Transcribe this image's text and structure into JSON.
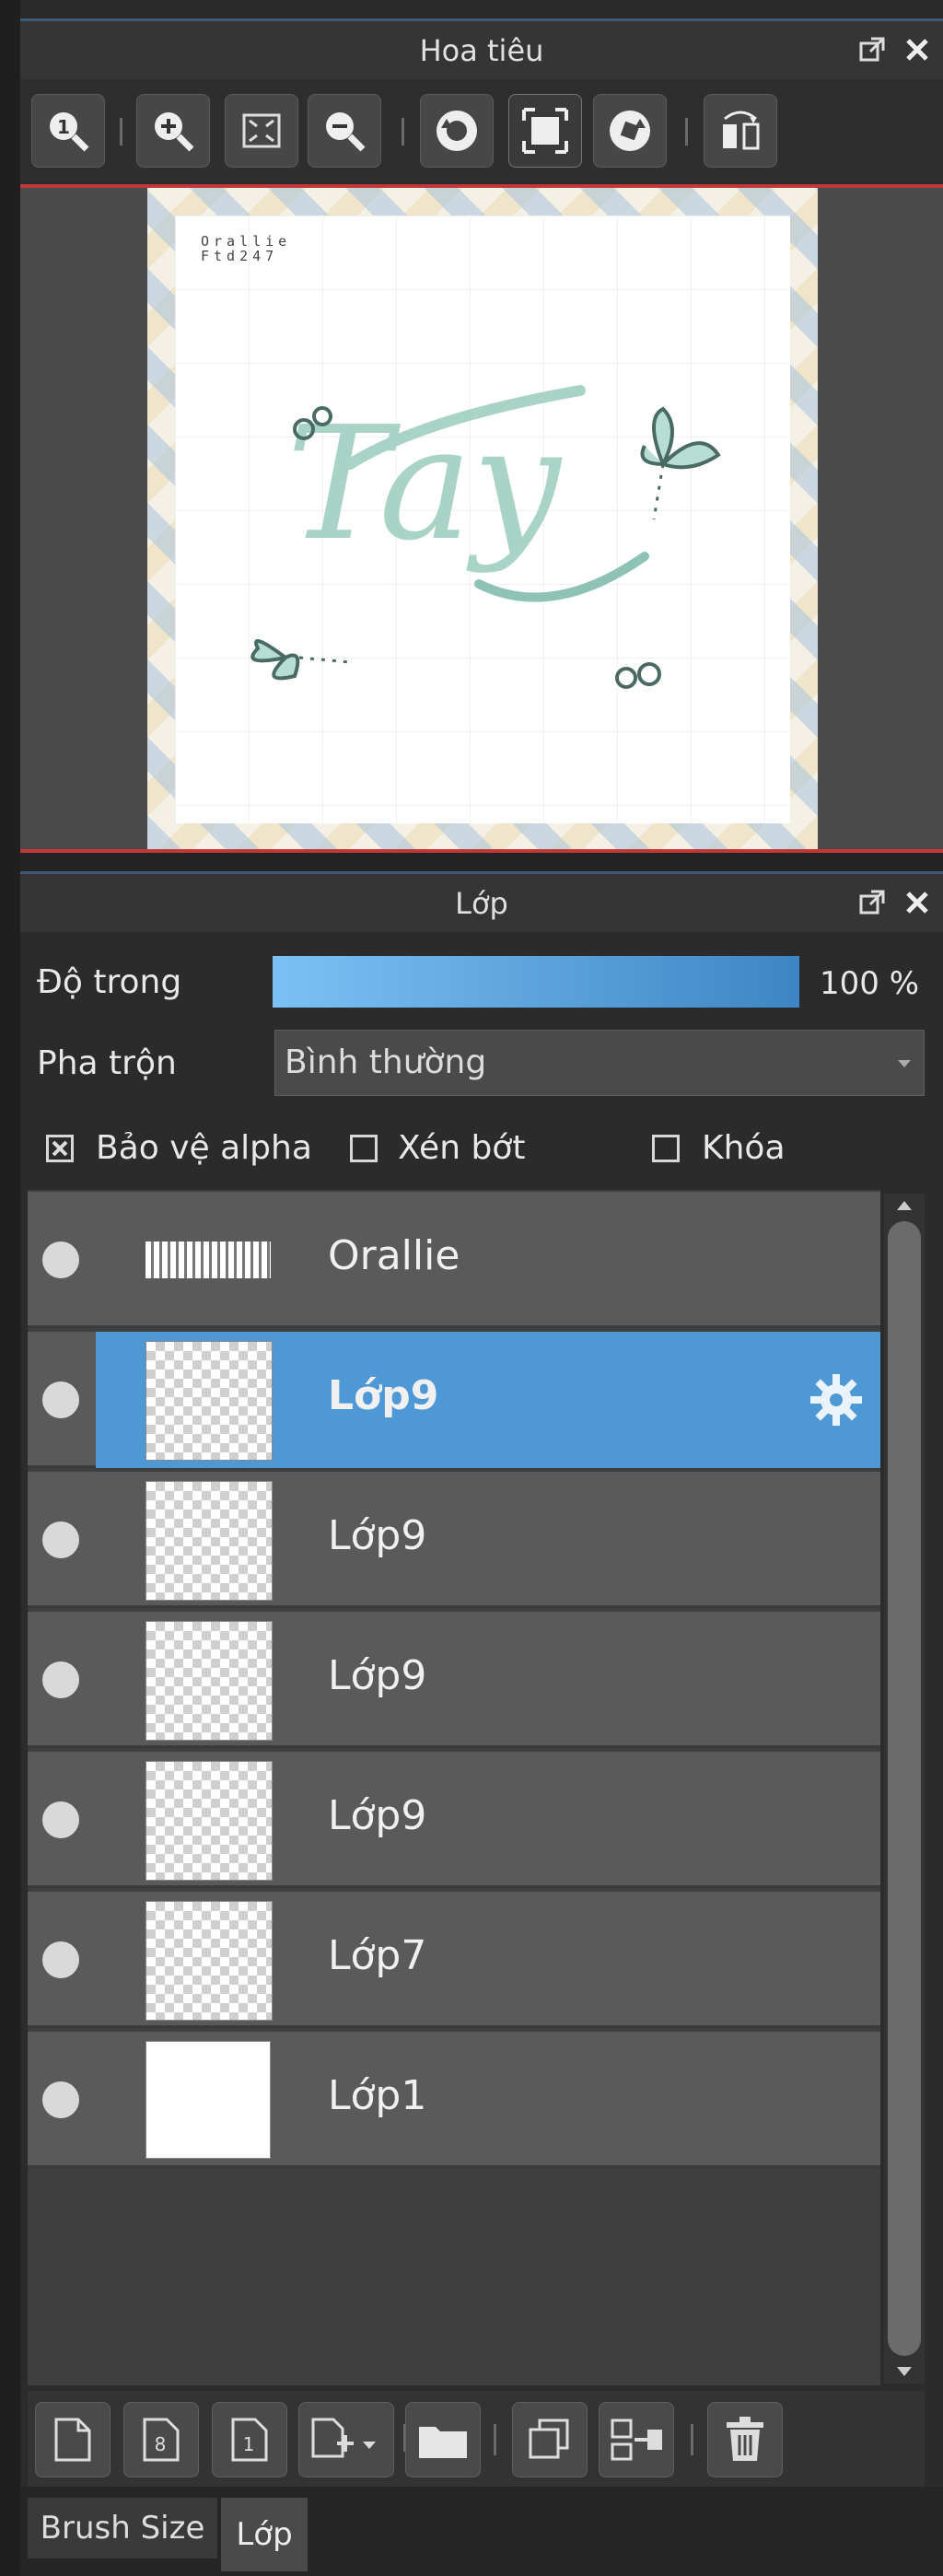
{
  "navigator": {
    "title": "Hoa tiêu",
    "toolbar": [
      "zoom-actual-icon",
      "zoom-in-icon",
      "fit-screen-icon",
      "zoom-out-icon",
      "rotate-left-icon",
      "fullscreen-icon",
      "rotate-right-icon",
      "flip-icon"
    ],
    "preview": {
      "watermark_line1": "Orallie",
      "watermark_line2": "Ftd247",
      "lettering": "Tay"
    }
  },
  "layers_panel": {
    "title": "Lớp",
    "opacity_label": "Độ trong",
    "opacity_value": "100 %",
    "opacity_fraction": 1.0,
    "blend_label": "Pha trộn",
    "blend_value": "Bình thường",
    "options": [
      {
        "label": "Bảo vệ alpha",
        "checked": true
      },
      {
        "label": "Xén bớt",
        "checked": false
      },
      {
        "label": "Khóa",
        "checked": false
      }
    ],
    "layers": [
      {
        "name": "Orallie",
        "selected": false
      },
      {
        "name": "Lớp9",
        "selected": true
      },
      {
        "name": "Lớp9",
        "selected": false
      },
      {
        "name": "Lớp9",
        "selected": false
      },
      {
        "name": "Lớp9",
        "selected": false
      },
      {
        "name": "Lớp7",
        "selected": false
      },
      {
        "name": "Lớp1",
        "selected": false
      }
    ],
    "bottom_toolbar": [
      "new-layer-icon",
      "new-8bit-layer-icon",
      "new-1bit-layer-icon",
      "add-layer-menu-icon",
      "folder-icon",
      "duplicate-icon",
      "merge-down-icon",
      "delete-icon"
    ]
  },
  "bottom_tabs": [
    {
      "label": "Brush Size",
      "active": false
    },
    {
      "label": "Lớp",
      "active": true
    }
  ],
  "colors": {
    "accent": "#4f98d6",
    "selected_row": "#4f98d6",
    "panel": "#2b2b2b"
  }
}
